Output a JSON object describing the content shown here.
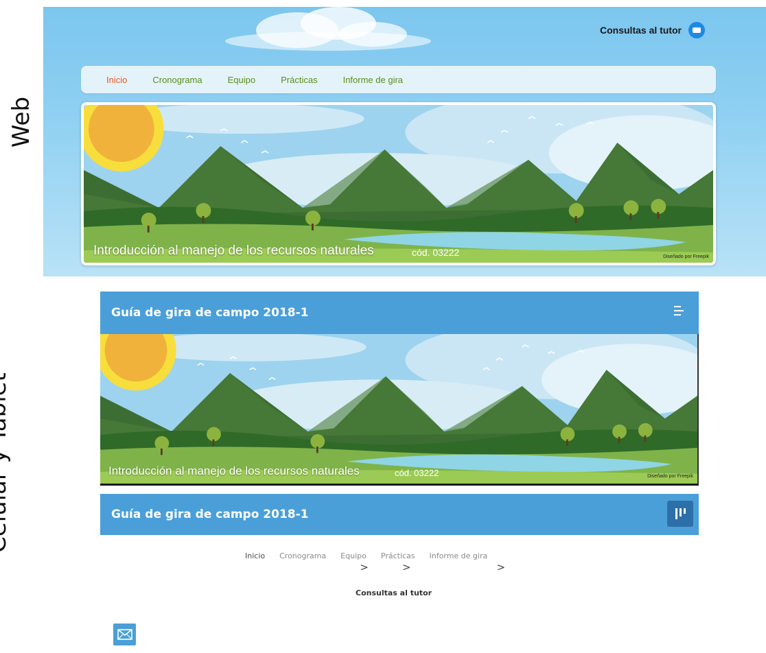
{
  "side_labels": {
    "web": "Web",
    "mobile": "Celular y Tablet"
  },
  "web": {
    "consult_label": "Consultas al tutor",
    "nav": [
      "Inicio",
      "Cronograma",
      "Equipo",
      "Prácticas",
      "Informe de gira"
    ],
    "active_nav": "Inicio",
    "banner": {
      "title": "Introducción al manejo de los recursos naturales",
      "code": "cód. 03222",
      "credit": "Diseñado por Freepik"
    }
  },
  "mobile": {
    "header_title": "Guía de gira de campo 2018-1",
    "banner": {
      "title": "Introducción al manejo de los recursos naturales",
      "code": "cód. 03222",
      "credit": "Diseñado por Freepik"
    },
    "header2_title": "Guía de gira de campo 2018-1",
    "nav": [
      "Inicio",
      "Cronograma",
      "Equipo",
      "Prácticas",
      "Informe de gira"
    ],
    "chevron": ">",
    "consult_label": "Consultas al tutor"
  },
  "colors": {
    "nav_active": "#e6571f",
    "nav_link": "#5a8d1a",
    "mobile_bar": "#4a9fd8",
    "toggle_btn": "#2d6fa8",
    "mail_icon": "#1e88e5"
  }
}
